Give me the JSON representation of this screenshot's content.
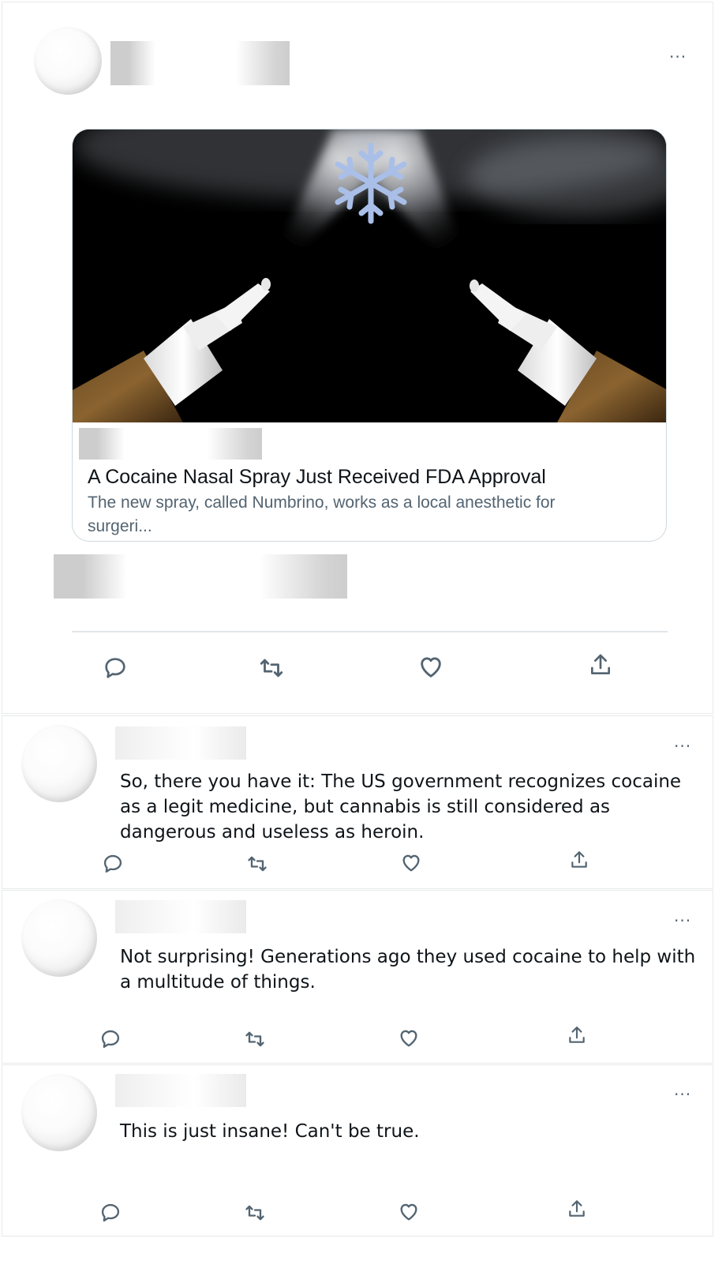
{
  "post": {
    "more_label": "···",
    "card": {
      "title": "A Cocaine Nasal Spray Just Received FDA Approval",
      "description": "The new spray, called Numbrino, works as a local anesthetic for surgeri..."
    },
    "actions": [
      "reply-icon",
      "retweet-icon",
      "like-icon",
      "share-icon"
    ]
  },
  "replies": [
    {
      "more_label": "···",
      "text": "So, there you have it: The US government recognizes cocaine as a legit medicine, but cannabis is still considered as dangerous and useless as heroin."
    },
    {
      "more_label": "···",
      "text": "Not surprising! Generations ago they used cocaine to help with a multitude of things."
    },
    {
      "more_label": "···",
      "text": "This is just insane! Can't be true."
    }
  ],
  "colors": {
    "icon": "#536471",
    "text": "#0f1419",
    "muted": "#536471",
    "border": "#cfd9de"
  }
}
